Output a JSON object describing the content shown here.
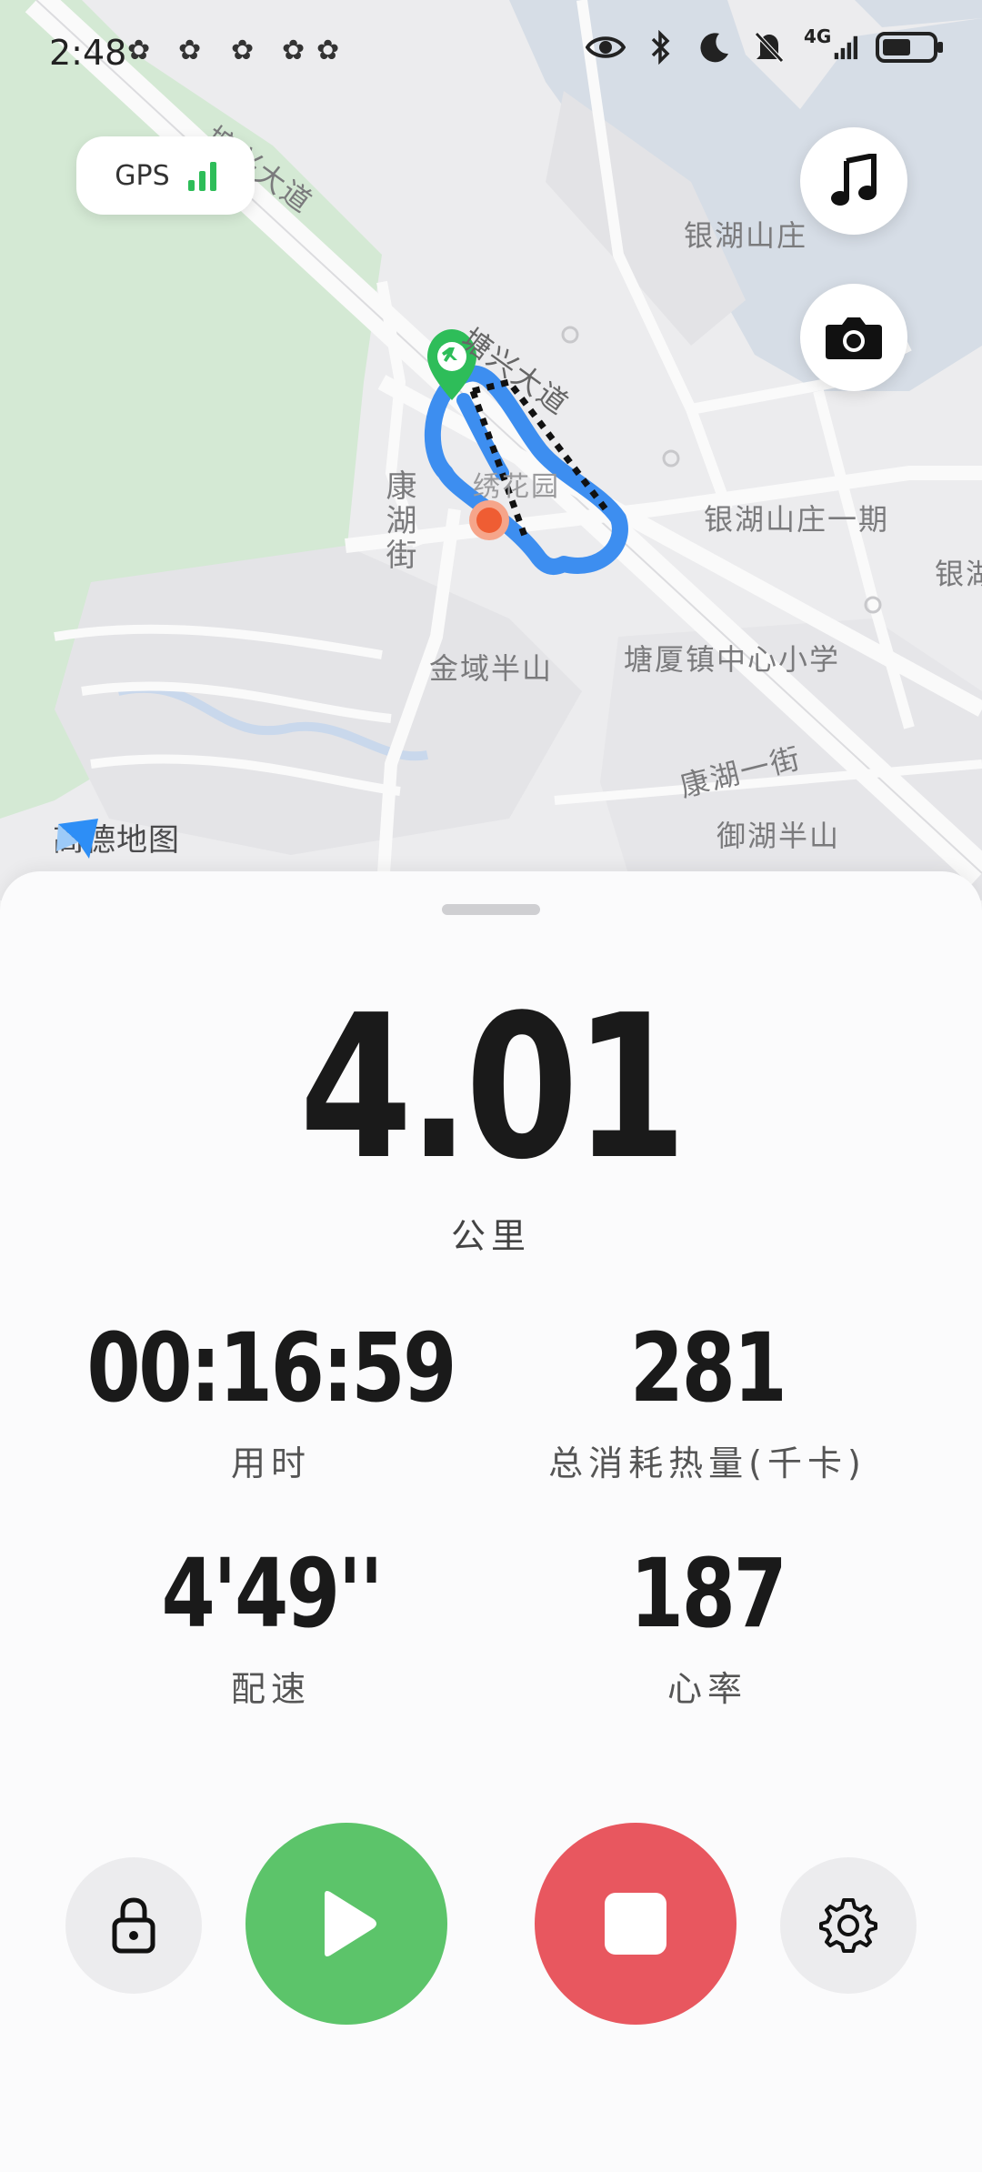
{
  "status_bar": {
    "time": "2:48",
    "network_label": "4G"
  },
  "gps": {
    "label": "GPS"
  },
  "map": {
    "provider_label": "高德地图",
    "labels": {
      "road_tangxing_1": "塘兴大道",
      "road_tangxing_2": "塘兴大道",
      "yinhu_shanzhuang": "银湖山庄",
      "yinhu_shanzhuang_1": "银湖山庄一期",
      "yinhu_edge": "银湖",
      "kanghu_street_v": "康湖街",
      "jinyu_banshan": "金域半山",
      "tangxia_school": "塘厦镇中心小学",
      "kanghu_1st_street": "康湖一街",
      "yuhu_banshan": "御湖半山",
      "park_partial": "绣花园"
    }
  },
  "workout": {
    "distance": "4.01",
    "distance_unit": "公里",
    "duration": "00:16:59",
    "duration_label": "用时",
    "calories": "281",
    "calories_label": "总消耗热量(千卡)",
    "pace": "4'49''",
    "pace_label": "配速",
    "heart_rate": "187",
    "heart_rate_label": "心率"
  },
  "colors": {
    "resume": "#5cc46a",
    "stop": "#e8575f",
    "route": "#3d8ef0",
    "gps_ok": "#2ebd59"
  }
}
